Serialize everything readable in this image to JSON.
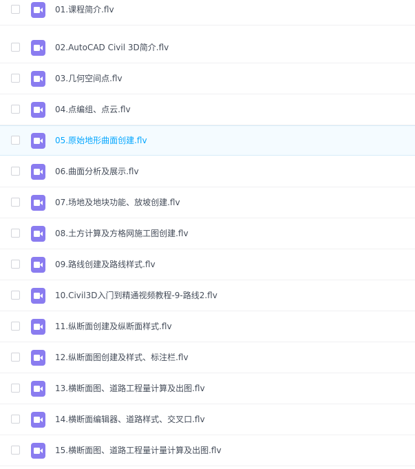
{
  "file_list": {
    "icon": "video-file-icon",
    "accent_color": "#06a7ff",
    "icon_color": "#8a7cf0",
    "items": [
      {
        "name": "01.课程简介.flv"
      },
      {
        "name": "02.AutoCAD Civil 3D简介.flv"
      },
      {
        "name": "03.几何空间点.flv"
      },
      {
        "name": "04.点编组、点云.flv"
      },
      {
        "name": "05.原始地形曲面创建.flv"
      },
      {
        "name": "06.曲面分析及展示.flv"
      },
      {
        "name": "07.场地及地块功能、放坡创建.flv"
      },
      {
        "name": "08.土方计算及方格网施工图创建.flv"
      },
      {
        "name": "09.路线创建及路线样式.flv"
      },
      {
        "name": "10.Civil3D入门到精通视频教程-9-路线2.flv"
      },
      {
        "name": "11.纵断面创建及纵断面样式.flv"
      },
      {
        "name": "12.纵断面图创建及样式、标注栏.flv"
      },
      {
        "name": "13.横断面图、道路工程量计算及出图.flv"
      },
      {
        "name": "14.横断面编辑器、道路样式、交叉口.flv"
      },
      {
        "name": "15.横断面图、道路工程量计量计算及出图.flv"
      }
    ]
  }
}
